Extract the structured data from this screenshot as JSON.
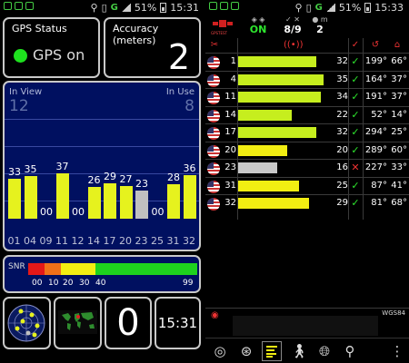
{
  "status_left": {
    "battery": "51%",
    "time": "15:31"
  },
  "status_right": {
    "battery": "51%",
    "time": "15:33"
  },
  "dashboard": {
    "gps_status_title": "GPS Status",
    "gps_status_value": "GPS on",
    "accuracy_title": "Accuracy (meters)",
    "accuracy_value": "2",
    "in_view_label": "In View",
    "in_view_value": "12",
    "in_use_label": "In Use",
    "in_use_value": "8",
    "snr_label": "SNR",
    "snr_ticks": [
      "00",
      "10",
      "20",
      "30",
      "40",
      "99"
    ],
    "speed_value": "0",
    "time_value": "15:31",
    "colors": {
      "used": "#e6f21e",
      "unused": "#c0c0c0",
      "panel_bg": "#001060",
      "gps_dot": "#1ee01e"
    },
    "icons": {
      "mini_sky": "sky-radar-icon",
      "mini_map": "world-map-icon"
    }
  },
  "chart_data": {
    "type": "bar",
    "categories": [
      "01",
      "04",
      "09",
      "11",
      "12",
      "14",
      "17",
      "20",
      "23",
      "25",
      "31",
      "32"
    ],
    "values": [
      33,
      35,
      0,
      37,
      0,
      26,
      29,
      27,
      23,
      0,
      28,
      36
    ],
    "used": [
      true,
      true,
      false,
      true,
      false,
      true,
      true,
      true,
      false,
      false,
      true,
      true
    ],
    "ylim": [
      0,
      99
    ],
    "grid": true
  },
  "sat_header": {
    "fix_label": "ON",
    "sats": "8/9",
    "altitude": "2",
    "alt_unit": "m",
    "logo_text": "GPSTEST"
  },
  "sat_table": {
    "rows": [
      {
        "prn": "1",
        "snr": "32",
        "used": true,
        "az": "199°",
        "el": "66°",
        "level": 32,
        "color": "#c6ee1e"
      },
      {
        "prn": "4",
        "snr": "35",
        "used": true,
        "az": "164°",
        "el": "37°",
        "level": 35,
        "color": "#c6ee1e"
      },
      {
        "prn": "11",
        "snr": "34",
        "used": true,
        "az": "191°",
        "el": "37°",
        "level": 34,
        "color": "#c6ee1e"
      },
      {
        "prn": "14",
        "snr": "22",
        "used": true,
        "az": "52°",
        "el": "14°",
        "level": 22,
        "color": "#c6ee1e"
      },
      {
        "prn": "17",
        "snr": "32",
        "used": true,
        "az": "294°",
        "el": "25°",
        "level": 32,
        "color": "#c6ee1e"
      },
      {
        "prn": "20",
        "snr": "20",
        "used": true,
        "az": "289°",
        "el": "60°",
        "level": 20,
        "color": "#f2ee12"
      },
      {
        "prn": "23",
        "snr": "16",
        "used": false,
        "az": "227°",
        "el": "33°",
        "level": 16,
        "color": "#c8c8c8"
      },
      {
        "prn": "31",
        "snr": "25",
        "used": true,
        "az": "87°",
        "el": "41°",
        "level": 25,
        "color": "#f2ee12"
      },
      {
        "prn": "32",
        "snr": "29",
        "used": true,
        "az": "81°",
        "el": "68°",
        "level": 29,
        "color": "#f2ee12"
      }
    ]
  },
  "location": {
    "datum": "WGS84"
  },
  "bottom_nav": {
    "items": [
      "compass-icon",
      "radar-icon",
      "signal-list-icon",
      "walk-icon",
      "globe-icon",
      "location-pin-icon",
      "more-icon"
    ]
  }
}
